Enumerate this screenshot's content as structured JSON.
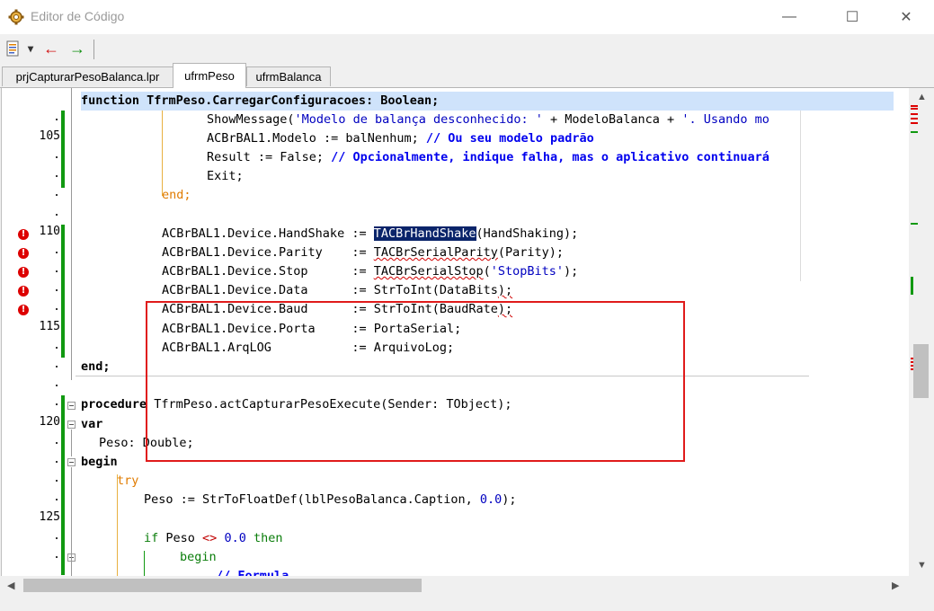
{
  "window": {
    "title": "Editor de Código",
    "minimize": "—",
    "maximize": "☐",
    "close": "✕"
  },
  "toolbar": {
    "dropdown": "▾",
    "back": "←",
    "forward": "→"
  },
  "tabs": [
    {
      "label": "prjCapturarPesoBalanca.lpr"
    },
    {
      "label": "ufrmPeso"
    },
    {
      "label": "ufrmBalanca"
    }
  ],
  "line_numbers": {
    "l105": "105",
    "l110": "110",
    "l115": "115",
    "l120": "120",
    "l125": "125"
  },
  "code": {
    "header": "function TfrmPeso.CarregarConfiguracoes: Boolean;",
    "l1_call": "ShowMessage(",
    "l1_str": "'Modelo de balança desconhecido: '",
    "l1_mid": " + ModeloBalanca + ",
    "l1_str2": "'. Usando mo",
    "l2_a": "ACBrBAL1.Modelo := balNenhum; ",
    "l2_cm": "// Ou seu modelo padrão",
    "l3_a": "Result := False; ",
    "l3_cm": "// Opcionalmente, indique falha, mas o aplicativo continuará",
    "l4": "Exit;",
    "l5": "end;",
    "b1_a": "ACBrBAL1.Device.HandShake := ",
    "b1_sel": "TACBrHandShake",
    "b1_b": "(HandShaking);",
    "b2_a": "ACBrBAL1.Device.Parity    := ",
    "b2_b": "TACBrSerialParity",
    "b2_c": "(Parity);",
    "b3_a": "ACBrBAL1.Device.Stop      := ",
    "b3_b": "TACBrSerialStop",
    "b3_c": "(",
    "b3_str": "'StopBits'",
    "b3_d": ");",
    "b4_a": "ACBrBAL1.Device.Data      := StrToInt(DataBits",
    "b4_b": ");",
    "b5_a": "ACBrBAL1.Device.Baud      := StrToInt(BaudRate",
    "b5_b": ");",
    "b6": "ACBrBAL1.Device.Porta     := PortaSerial;",
    "b7": "ACBrBAL1.ArqLOG           := ArquivoLog;",
    "end1": "end;",
    "proc_kw": "procedure",
    "proc_rest": " TfrmPeso.actCapturarPesoExecute(Sender: TObject);",
    "var": "var",
    "peso_decl": "Peso: Double;",
    "begin": "begin",
    "try": "try",
    "peso_assign_a": "Peso := StrToFloatDef(lblPesoBalanca.Caption, ",
    "peso_num": "0.0",
    "peso_assign_b": ");",
    "if_kw": "if",
    "if_mid": " Peso ",
    "if_op": "<>",
    "if_num": " 0.0 ",
    "then_kw": "then",
    "begin2": "begin",
    "cut": "// Formula ... ... ... ... ... "
  },
  "colors": {
    "modified": "#119911",
    "error": "#dd0000",
    "highlight_box": "#e01b1b",
    "selection": "#0a246a"
  }
}
